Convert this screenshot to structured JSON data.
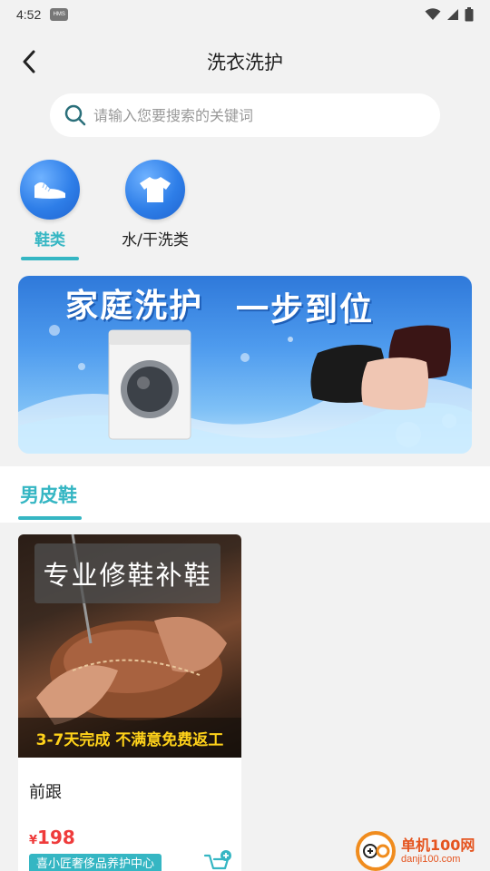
{
  "status_bar": {
    "time": "4:52",
    "hms_badge": "HMS"
  },
  "header": {
    "title": "洗衣洗护"
  },
  "search": {
    "placeholder": "请输入您要搜索的关键词"
  },
  "categories": [
    {
      "label": "鞋类",
      "icon": "shoe-icon",
      "active": true
    },
    {
      "label": "水/干洗类",
      "icon": "tshirt-icon",
      "active": false
    }
  ],
  "banner": {
    "text_left": "家庭洗护",
    "text_right": "一步到位"
  },
  "section": {
    "title": "男皮鞋"
  },
  "products": [
    {
      "image_caption": "专业修鞋补鞋",
      "image_strip": "3-7天完成 不满意免费返工",
      "name": "前跟",
      "currency": "¥",
      "price": "198",
      "shop": "喜小匠奢侈品养护中心"
    }
  ],
  "watermark": {
    "main": "单机100网",
    "sub": "danji100.com"
  },
  "colors": {
    "accent": "#35b6c3",
    "price": "#ef3b3b",
    "icon_blue": "#2e7ee8"
  }
}
